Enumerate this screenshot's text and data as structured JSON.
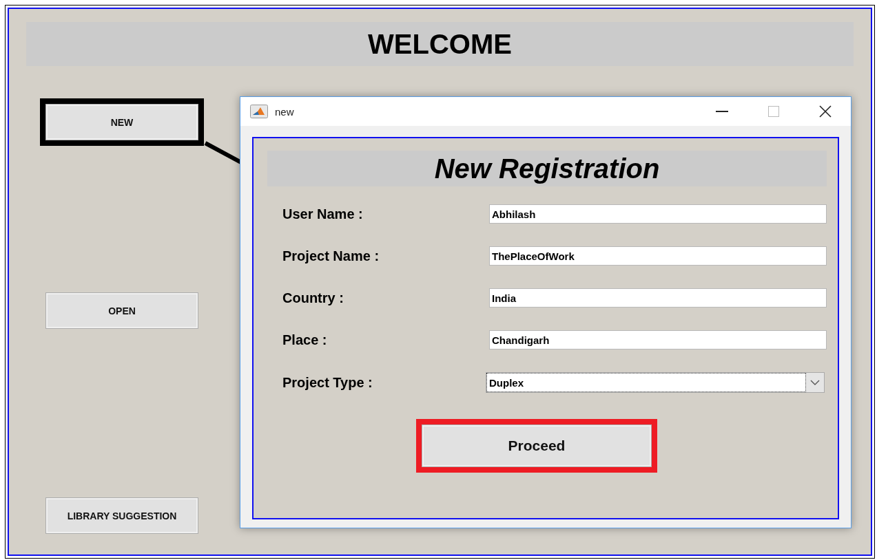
{
  "main": {
    "title": "WELCOME",
    "buttons": [
      {
        "label": "NEW",
        "highlighted": true
      },
      {
        "label": "OPEN",
        "highlighted": false
      },
      {
        "label": "LIBRARY SUGGESTION",
        "highlighted": false
      }
    ]
  },
  "dialog": {
    "title": "new",
    "heading": "New Registration",
    "fields": [
      {
        "kind": "text",
        "label": "User Name :",
        "value": "Abhilash"
      },
      {
        "kind": "text",
        "label": "Project Name :",
        "value": "ThePlaceOfWork"
      },
      {
        "kind": "text",
        "label": "Country :",
        "value": "India"
      },
      {
        "kind": "text",
        "label": "Place :",
        "value": "Chandigarh"
      },
      {
        "kind": "dropdown",
        "label": "Project Type :",
        "value": "Duplex"
      }
    ],
    "button": {
      "label": "Proceed",
      "highlighted": true
    }
  }
}
